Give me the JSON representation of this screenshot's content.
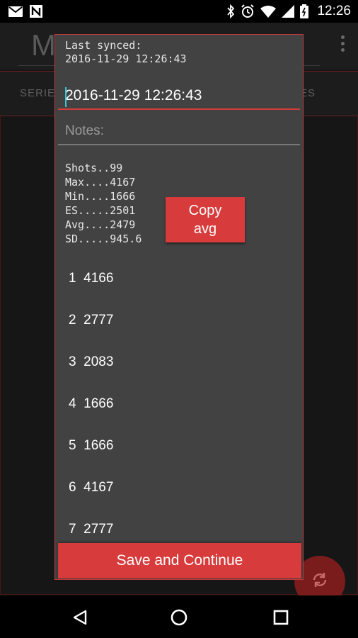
{
  "status_bar": {
    "time": "12:26",
    "left_icons": [
      "gmail-icon",
      "n-icon"
    ],
    "right_icons": [
      "bluetooth-icon",
      "alarm-icon",
      "wifi-icon",
      "signal-icon",
      "battery-icon"
    ]
  },
  "background_app": {
    "title": "M",
    "tabs": [
      "SERIE",
      "ES"
    ]
  },
  "dialog": {
    "last_synced_label": "Last synced:",
    "last_synced_value": "2016-11-29 12:26:43",
    "title_value": "2016-11-29 12:26:43",
    "notes_placeholder": "Notes:",
    "stats": [
      "Shots..99",
      "Max....4167",
      "Min....1666",
      "ES.....2501",
      "Avg....2479",
      "SD.....945.6"
    ],
    "copy_avg_label_line1": "Copy",
    "copy_avg_label_line2": "avg",
    "shots": [
      "1  4166",
      "2  2777",
      "3  2083",
      "4  1666",
      "5  1666",
      "6  4167",
      "7  2777"
    ],
    "save_label": "Save and Continue"
  },
  "colors": {
    "accent": "#d73b3b",
    "dialog_bg": "#424242",
    "cursor": "#3cc7d4"
  },
  "nav": {
    "icons": [
      "back-icon",
      "home-icon",
      "recents-icon"
    ]
  }
}
